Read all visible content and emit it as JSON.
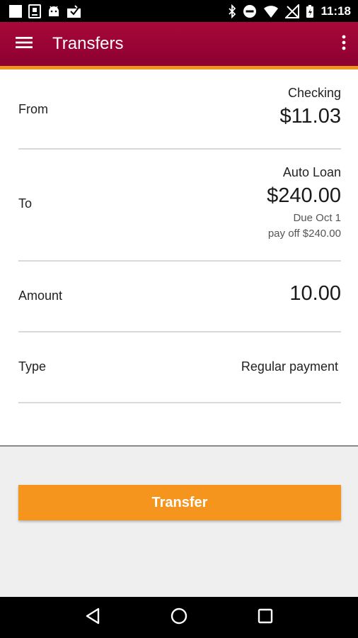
{
  "status_bar": {
    "time": "11:18",
    "left_icons": [
      "square-notification-icon",
      "download-notification-icon",
      "android-notification-icon",
      "mail-check-notification-icon"
    ],
    "right_icons": [
      "bluetooth-icon",
      "do-not-disturb-icon",
      "wifi-icon",
      "no-signal-icon",
      "battery-icon"
    ]
  },
  "app_bar": {
    "title": "Transfers",
    "background_color": "#980036",
    "accent_color": "#f0931f"
  },
  "form": {
    "from": {
      "label": "From",
      "account_name": "Checking",
      "balance": "$11.03"
    },
    "to": {
      "label": "To",
      "account_name": "Auto Loan",
      "balance": "$240.00",
      "due": "Due Oct 1",
      "payoff": "pay off $240.00"
    },
    "amount": {
      "label": "Amount",
      "value": "10.00"
    },
    "type": {
      "label": "Type",
      "value": "Regular payment"
    }
  },
  "actions": {
    "transfer_label": "Transfer",
    "button_color": "#f5951e"
  },
  "nav_bar": {
    "icons": [
      "back-icon",
      "home-icon",
      "recents-icon"
    ]
  }
}
